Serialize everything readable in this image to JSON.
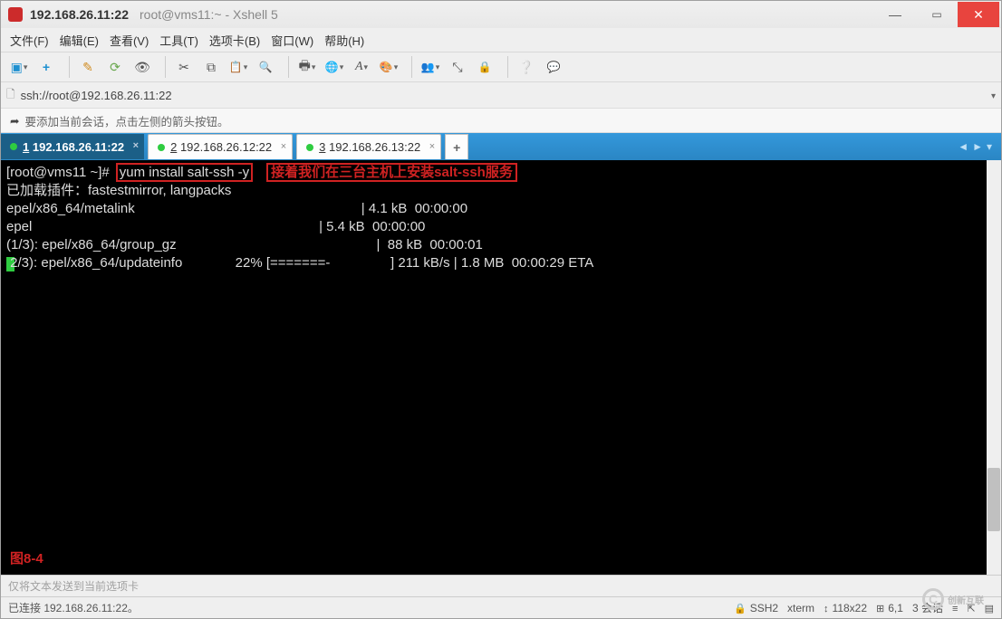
{
  "title": {
    "ip": "192.168.26.11:22",
    "rest": "root@vms11:~ - Xshell 5"
  },
  "menu": {
    "file": "文件(F)",
    "edit": "编辑(E)",
    "view": "查看(V)",
    "tools": "工具(T)",
    "tabs": "选项卡(B)",
    "window": "窗口(W)",
    "help": "帮助(H)"
  },
  "address": "ssh://root@192.168.26.11:22",
  "hint": "要添加当前会话，点击左侧的箭头按钮。",
  "tabs": [
    {
      "num": "1",
      "label": "192.168.26.11:22",
      "active": true
    },
    {
      "num": "2",
      "label": "192.168.26.12:22",
      "active": false
    },
    {
      "num": "3",
      "label": "192.168.26.13:22",
      "active": false
    }
  ],
  "term": {
    "prompt": "[root@vms11 ~]#",
    "command": "yum install salt-ssh -y",
    "annotation": "接着我们在三台主机上安装salt-ssh服务",
    "lines": [
      "已加载插件：fastestmirror, langpacks",
      "epel/x86_64/metalink                                                            | 4.1 kB  00:00:00     ",
      "epel                                                                            | 5.4 kB  00:00:00     ",
      "(1/3): epel/x86_64/group_gz                                                     |  88 kB  00:00:01     ",
      " 2/3): epel/x86_64/updateinfo              22% [=======-                ] 211 kB/s | 1.8 MB  00:00:29 ETA "
    ],
    "figlabel": "图8-4"
  },
  "sendbar": "仅将文本发送到当前选项卡",
  "status": {
    "conn": "已连接 192.168.26.11:22。",
    "proto": "SSH2",
    "term": "xterm",
    "size": "118x22",
    "pos": "6,1",
    "sessions": "3 会话"
  },
  "watermark": {
    "brand": "创新互联"
  }
}
